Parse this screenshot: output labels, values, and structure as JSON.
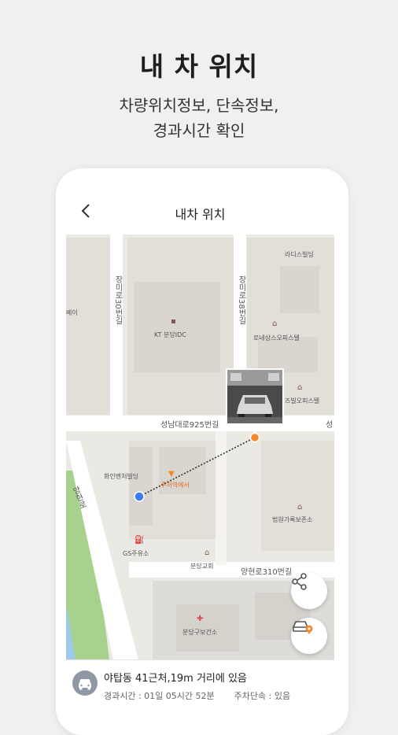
{
  "promo": {
    "title": "내 차 위치",
    "subtitle_line1": "차량위치정보, 단속정보,",
    "subtitle_line2": "경과시간 확인"
  },
  "appbar": {
    "back_icon": "chevron-left-icon",
    "title": "내차 위치"
  },
  "map": {
    "road_labels": {
      "seongnam_daero": "성남대로925번길",
      "seongnam_edge": "성",
      "yanghyeon_310": "양현로310번길",
      "yanghyeon_ro": "양현로",
      "jangmi_30_left": "장미로30번길",
      "jangmi_38": "장미로38번길"
    },
    "place_labels": {
      "radisseu": "라디스빌딩",
      "kt": "KT 분당IDC",
      "ronesangseu": "로네상스오피스텔",
      "jeonseu": "즈빌오피스텔",
      "hwain": "화인벤처빌딩",
      "jeoyeok": "주저역에서",
      "gs": "GS주유소",
      "bundang_church": "분당교회",
      "bundang_health": "분당구보건소",
      "bundang_court": "법원가록보존소",
      "left_edge": "베이"
    },
    "colors": {
      "phone_marker": "#3d7cf0",
      "car_marker": "#f5882a",
      "park": "#a9d18e",
      "health_cross": "#e04a4a"
    }
  },
  "fabs": {
    "share_icon": "share-icon",
    "car_location_icon": "car-location-icon"
  },
  "info": {
    "car_icon": "car-icon",
    "location_text": "야탑동 41근처,19m 거리에 있음",
    "elapsed_label": "경과시간 : 01일 05시간 52분",
    "enforcement_label": "주차단속 : 있음"
  }
}
